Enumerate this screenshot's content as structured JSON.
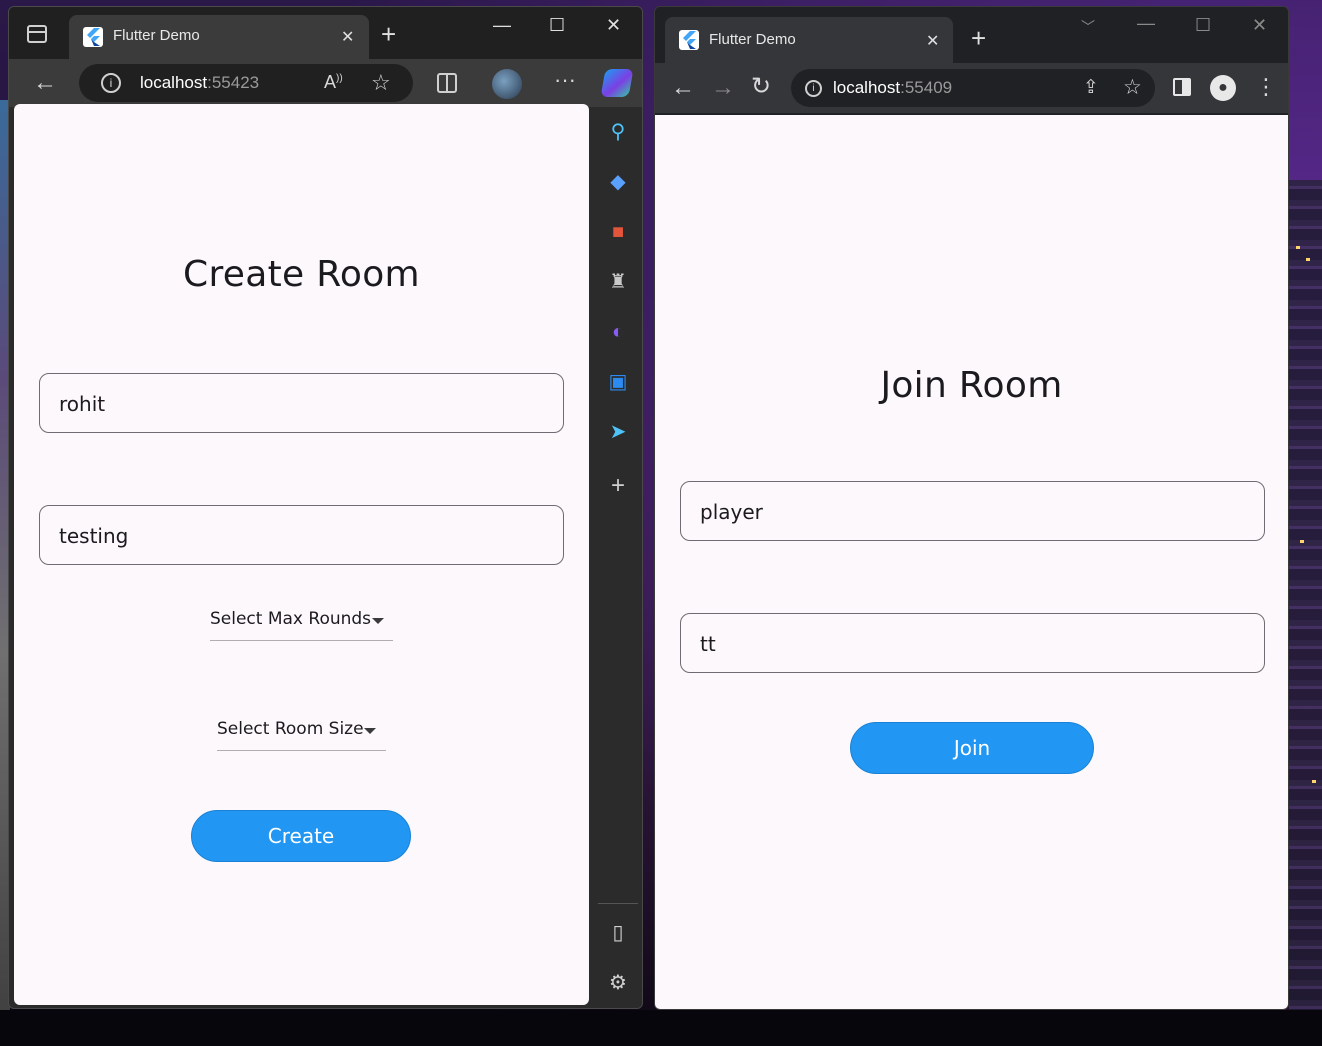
{
  "edge_window": {
    "tab_title": "Flutter Demo",
    "tab_close": "✕",
    "new_tab": "+",
    "minimize": "—",
    "maximize": "☐",
    "close": "✕",
    "address": {
      "host": "localhost",
      "port": ":55423"
    },
    "icons": [
      "tab-actions-icon",
      "back-arrow-icon",
      "site-info-icon",
      "read-aloud-icon",
      "favorite-star-icon",
      "split-screen-icon",
      "profile-avatar",
      "more-options-icon",
      "copilot-icon"
    ],
    "sidebar_icons": [
      "search-icon",
      "shopping-tag-icon",
      "tools-icon",
      "games-icon",
      "microsoft365-icon",
      "outlook-icon",
      "drop-icon",
      "add-icon",
      "sidebar-toggle-icon",
      "settings-gear-icon"
    ],
    "app": {
      "title": "Create Room",
      "name_value": "rohit",
      "room_value": "testing",
      "max_rounds_label": "Select Max Rounds",
      "room_size_label": "Select Room Size",
      "create_button": "Create"
    }
  },
  "chrome_window": {
    "tab_title": "Flutter Demo",
    "tab_close": "✕",
    "new_tab": "+",
    "address": {
      "host": "localhost",
      "port": ":55409"
    },
    "icons": [
      "back-arrow-icon",
      "forward-arrow-icon",
      "reload-icon",
      "site-info-icon",
      "share-icon",
      "bookmark-star-icon",
      "side-panel-icon",
      "profile-icon",
      "menu-icon"
    ],
    "app": {
      "title": "Join Room",
      "name_value": "player",
      "room_value": "tt",
      "join_button": "Join"
    }
  },
  "colors": {
    "primary_button": "#2196f3",
    "app_background": "#fdf8fc",
    "edge_chrome": "#3b3b3b",
    "chrome_chrome": "#35363a"
  }
}
